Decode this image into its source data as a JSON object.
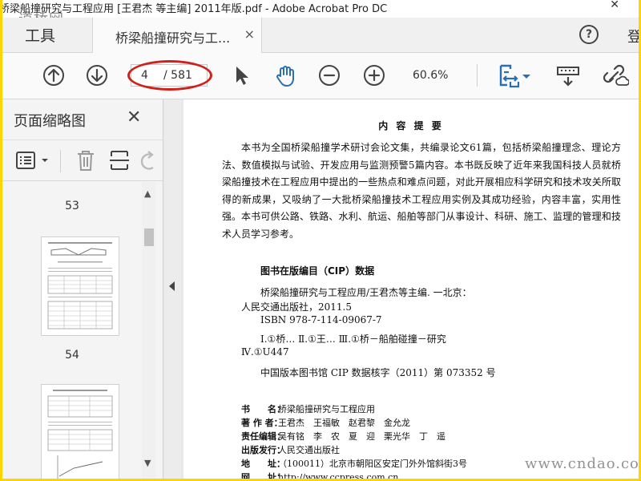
{
  "window": {
    "title": "桥梁船撞研究与工程应用 [王君杰 等主编] 2011年版.pdf - Adobe Acrobat Pro DC",
    "watermark_top": "道桥网",
    "watermark_bottom": "www.cndao.com"
  },
  "tabs": {
    "tools_label": "工具",
    "document_label": "桥梁船撞研究与工...",
    "close_symbol": "×",
    "login_label": "登"
  },
  "toolbar": {
    "current_page": "4",
    "total_pages": "/ 581",
    "zoom": "60.6%"
  },
  "left_pane": {
    "title": "页面缩略图",
    "close_symbol": "✕",
    "thumbnails": [
      {
        "page": "53"
      },
      {
        "page": "54"
      }
    ]
  },
  "document": {
    "heading": "内 容 提 要",
    "paragraphs": [
      "本书为全国桥梁船撞学术研讨会论文集，共编录论文61篇，包括桥梁船撞理念、理论方法、数值模拟与试验、开发应用与监测预警5篇内容。本书既反映了近年来我国科技人员就桥梁船撞技术在工程应用中提出的一些热点和难点问题，对此开展相应科学研究和技术攻关所取得的新成果，又吸纳了一大批桥梁船撞技术工程应用实例及其成功经验，内容丰富，实用性强。",
      "本书可供公路、铁路、水利、航运、船舶等部门从事设计、科研、施工、监理的管理和技术人员学习参考。"
    ],
    "cip": {
      "title": "图书在版编目（CIP）数据",
      "line1": "桥梁船撞研究与工程应用/王君杰等主编. 一北京：",
      "line2": "人民交通出版社，2011.5",
      "line3": "ISBN  978-7-114-09067-7",
      "line4": "Ⅰ.①桥…   Ⅱ.①王…   Ⅲ.①桥－船舶碰撞－研究",
      "line5": "Ⅳ.①U447",
      "line6": "中国版本图书馆 CIP 数据核字（2011）第 073352 号"
    },
    "info": [
      {
        "key": "书　　名：",
        "value": "桥梁船撞研究与工程应用"
      },
      {
        "key": "著 作 者：",
        "value": "王君杰　王福敏　赵君黎　金允龙"
      },
      {
        "key": "责任编辑：",
        "value": "吴有铭　李　农　夏　迎　栗光华　丁　遥"
      },
      {
        "key": "出版发行：",
        "value": "人民交通出版社"
      },
      {
        "key": "地　　址：",
        "value": "（100011）北京市朝阳区安定门外外馆斜街3号"
      },
      {
        "key": "网　　址：",
        "value": "http://www.ccpress.com.cn"
      }
    ]
  },
  "colors": {
    "frame_border": "#ffd400",
    "annotation_red": "#d0201c"
  }
}
